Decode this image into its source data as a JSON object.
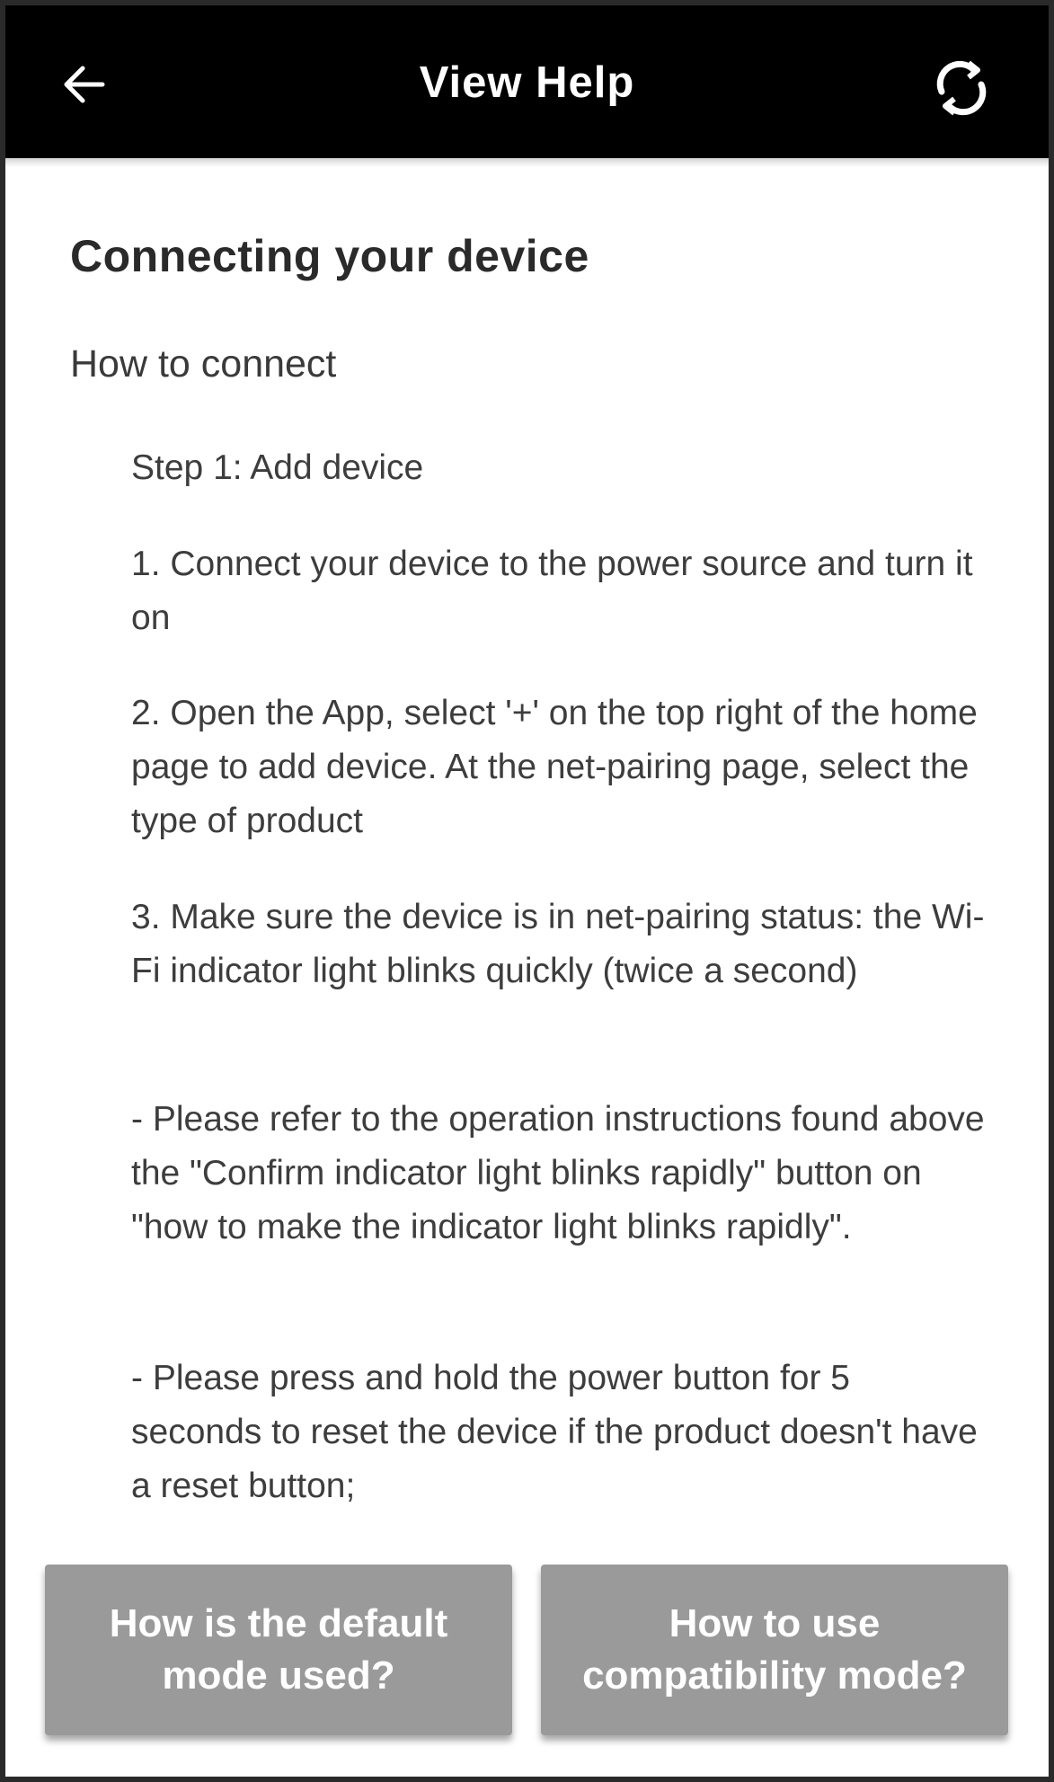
{
  "header": {
    "title": "View Help",
    "back_icon": "arrow-left-icon",
    "refresh_icon": "refresh-icon"
  },
  "content": {
    "section_title": "Connecting your device",
    "subtitle": "How to connect",
    "paragraphs": [
      "Step 1: Add device",
      "1. Connect your device to the power source and turn it on",
      "2. Open the App, select '+' on the top right of the home page to add device. At the net-pairing page, select the type of product",
      "3. Make sure the device is in net-pairing status: the Wi-Fi indicator light blinks quickly (twice a second)",
      "- Please refer to the operation instructions found above the \"Confirm indicator light blinks rapidly\" button on \"how to make the indicator light blinks rapidly\".",
      "- Please press and hold the power button for 5 seconds to reset the device if the product doesn't have a reset button;"
    ]
  },
  "buttons": {
    "default_mode": "How is the default mode used?",
    "compatibility_mode": "How to use compatibility mode?"
  },
  "colors": {
    "header_bg": "#000000",
    "button_bg": "#9a9a9a",
    "text": "#3d3d3d"
  }
}
